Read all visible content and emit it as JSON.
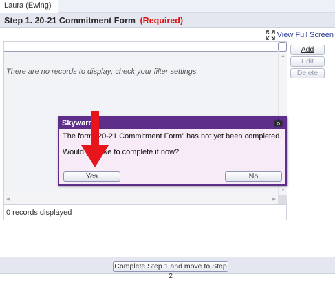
{
  "tabs": {
    "student": "Laura (Ewing)"
  },
  "header": {
    "step_title": "Step 1. 20-21 Commitment Form",
    "required_label": "(Required)"
  },
  "toolbar": {
    "view_full_screen": "View Full Screen"
  },
  "grid": {
    "empty_message": "There are no records to display; check your filter settings.",
    "records_count": "0 records displayed"
  },
  "side_buttons": {
    "add": "Add",
    "edit": "Edit",
    "delete": "Delete"
  },
  "dialog": {
    "title": "Skyward",
    "message_line1": "The form \"20-21 Commitment Form\" has not yet been completed.",
    "message_line2": "Would you like to complete it now?",
    "yes": "Yes",
    "no": "No"
  },
  "footer": {
    "complete_button": "Complete Step 1 and move to Step 2"
  },
  "colors": {
    "dialog_title_bg": "#5d2f8a",
    "required_text": "#dd1515",
    "arrow": "#e8141b"
  },
  "icons": [
    "expand-icon",
    "camera-icon",
    "scroll-up-icon",
    "scroll-down-icon",
    "scroll-left-icon",
    "scroll-right-icon"
  ]
}
